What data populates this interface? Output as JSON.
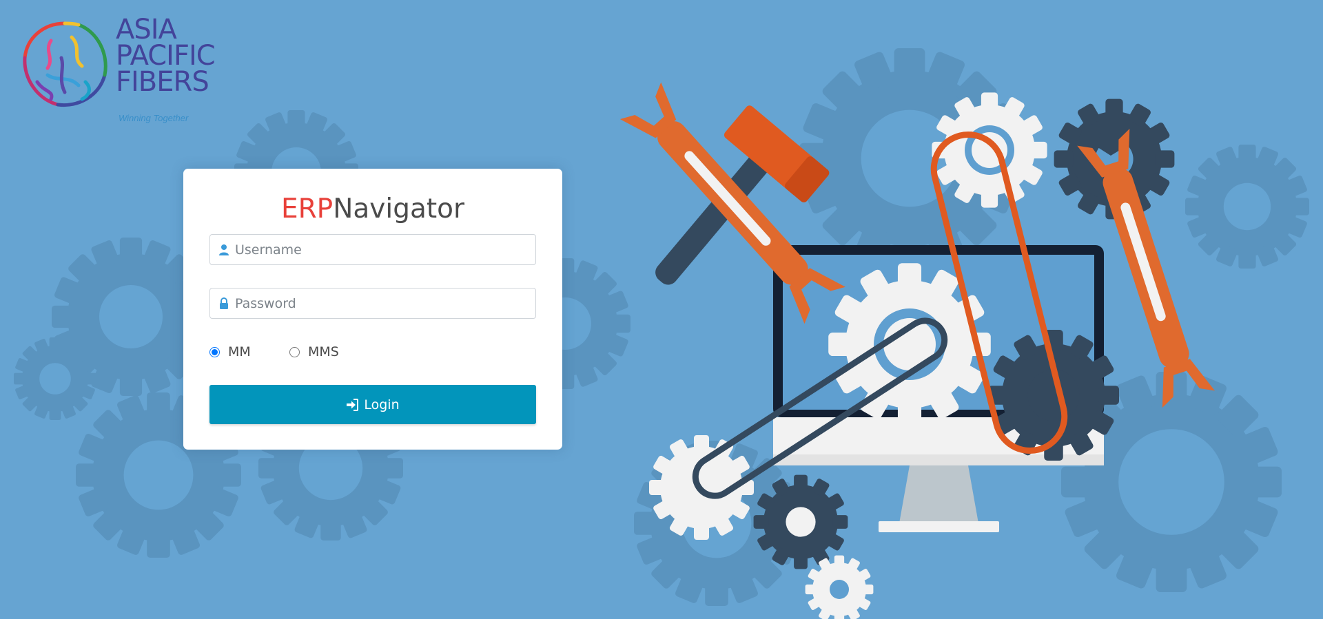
{
  "logo": {
    "lines": [
      "ASIA",
      "PACIFIC",
      "FIBERS"
    ],
    "tagline": "Winning Together"
  },
  "app": {
    "title_accent": "ERP",
    "title_rest": "Navigator"
  },
  "form": {
    "username": {
      "value": "",
      "placeholder": "Username",
      "icon": "user-icon"
    },
    "password": {
      "value": "",
      "placeholder": "Password",
      "icon": "lock-icon"
    },
    "options": [
      {
        "label": "MM",
        "selected": true
      },
      {
        "label": "MMS",
        "selected": false
      }
    ],
    "login_label": "Login",
    "login_icon": "sign-in-icon"
  },
  "colors": {
    "background": "#66a4d2",
    "title_accent": "#e8413a",
    "button": "#0295bb",
    "logo_text": "#43449a"
  }
}
